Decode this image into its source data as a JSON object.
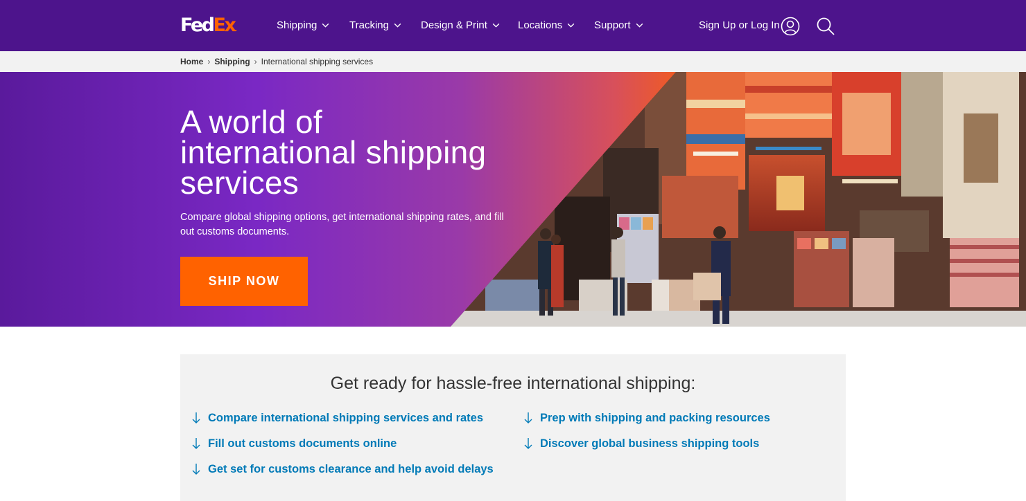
{
  "header": {
    "logo_main": "Fed",
    "logo_accent": "Ex",
    "logo_dot": ".",
    "nav": [
      {
        "label": "Shipping"
      },
      {
        "label": "Tracking"
      },
      {
        "label": "Design & Print"
      },
      {
        "label": "Locations"
      },
      {
        "label": "Support"
      }
    ],
    "signin_label": "Sign Up or Log In"
  },
  "breadcrumb": {
    "items": [
      "Home",
      "Shipping"
    ],
    "current": "International shipping services"
  },
  "hero": {
    "title_line1": "A world of",
    "title_line2": "international shipping",
    "title_line3": "services",
    "subtitle": "Compare global shipping options, get international shipping rates, and fill out  customs documents.",
    "cta_label": "SHIP NOW"
  },
  "section": {
    "title": "Get ready for hassle-free international shipping:",
    "links_left": [
      "Compare international shipping services and rates",
      "Fill out customs documents online",
      "Get set for customs clearance and help avoid delays"
    ],
    "links_right": [
      "Prep with shipping and packing resources",
      "Discover global business shipping tools"
    ]
  },
  "colors": {
    "brand_purple": "#4d148c",
    "brand_orange": "#ff6200",
    "link_blue": "#007ab7",
    "panel_gray": "#f2f2f2"
  },
  "icons": [
    "chevron-down-icon",
    "user-icon",
    "search-icon",
    "arrow-down-icon"
  ]
}
